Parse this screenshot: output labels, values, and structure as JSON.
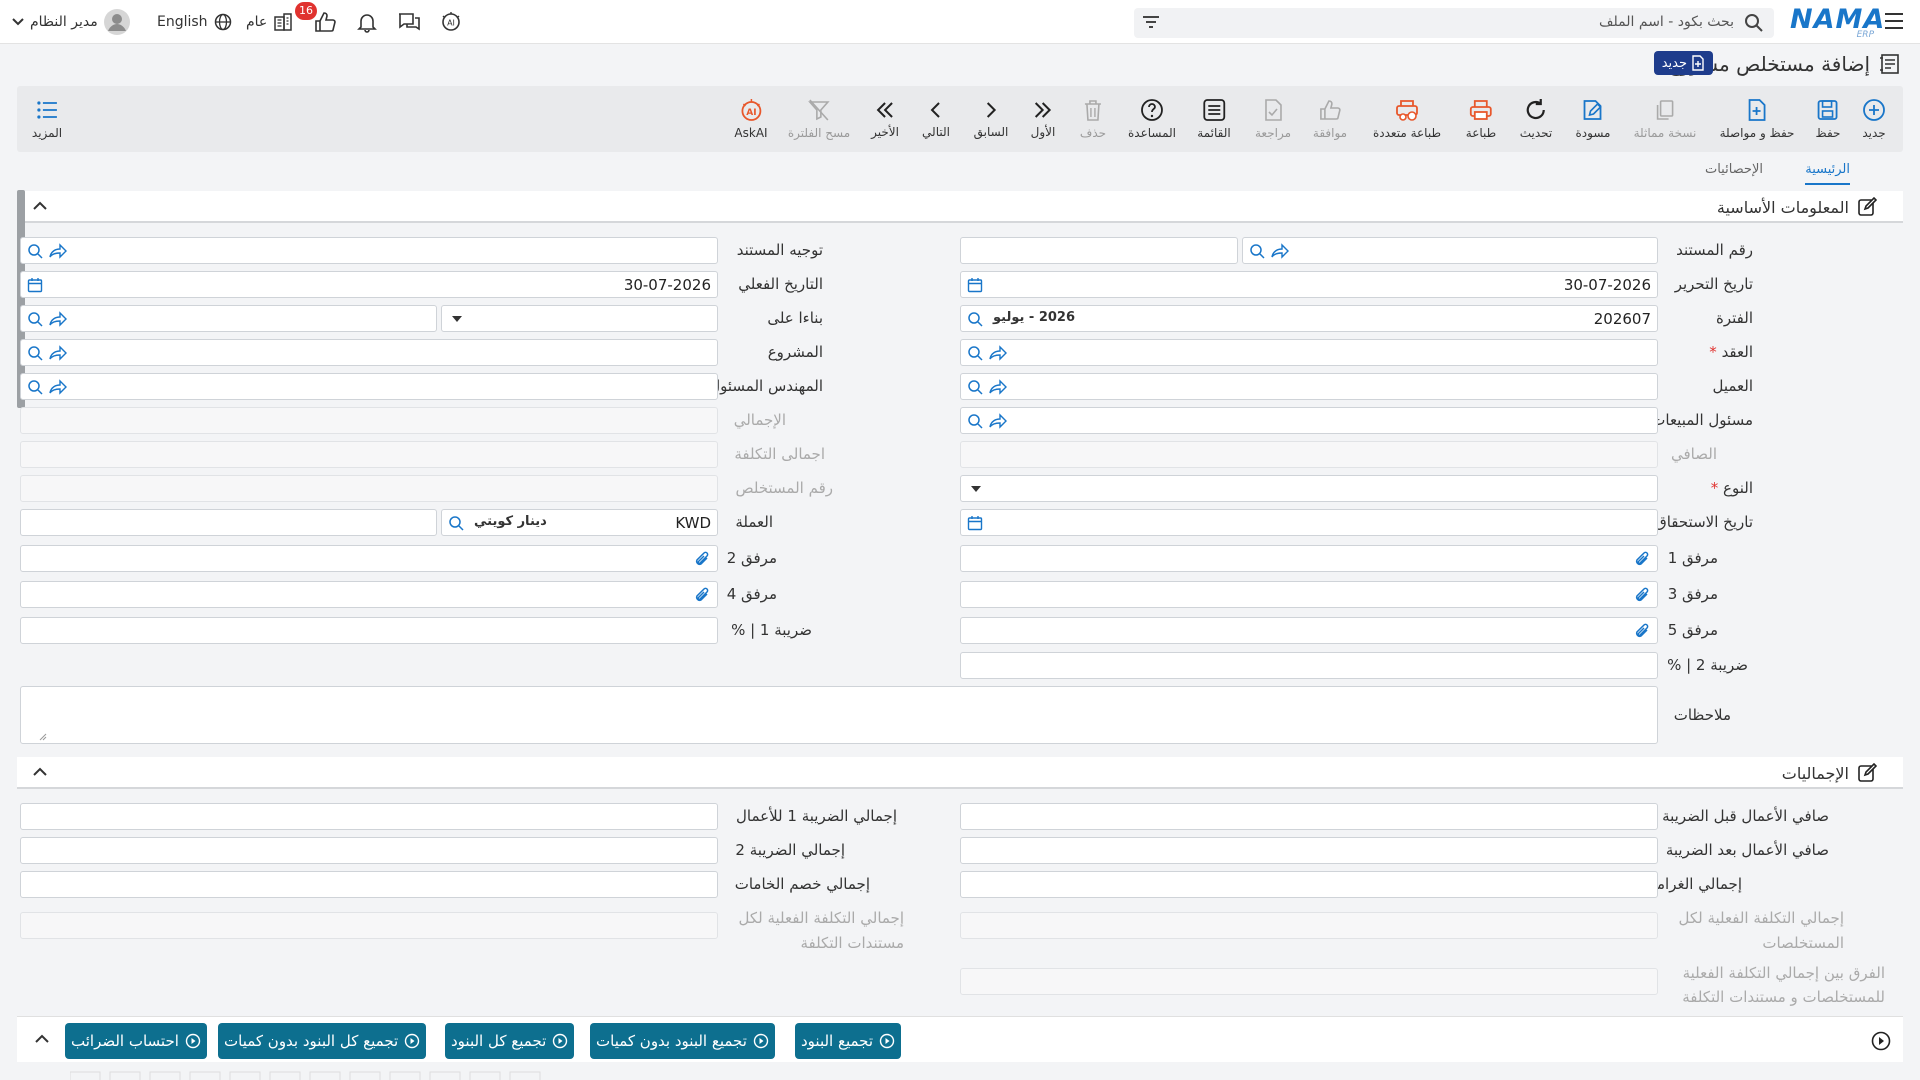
{
  "topbar": {
    "logo_main": "NAMA",
    "logo_sub": "ERP",
    "search_placeholder": "بحث بكود - اسم الملف",
    "user_name": "مدير النظام",
    "language": "English",
    "scope": "عام",
    "notifications_count": "16"
  },
  "page": {
    "title": "إضافة مستخلص مشروع",
    "new_badge": "جديد"
  },
  "toolbar": {
    "new": "جديد",
    "save": "حفظ",
    "save_continue": "حفظ و مواصلة",
    "copy": "نسخة مماثلة",
    "draft": "مسودة",
    "refresh": "تحديث",
    "print": "طباعة",
    "multi_print": "طباعة متعددة",
    "approve": "موافقة",
    "review": "مراجعة",
    "list": "القائمة",
    "help": "المساعدة",
    "delete": "حذف",
    "first": "الأول",
    "previous": "السابق",
    "next": "التالي",
    "last": "الأخير",
    "clear_filter": "مسح الفلترة",
    "askai": "AskAI",
    "more": "المزيد"
  },
  "tabs": {
    "main": "الرئيسية",
    "stats": "الإحصائيات"
  },
  "basic": {
    "title": "المعلومات الأساسية",
    "doc_number_label": "رقم المستند",
    "doc_direction_label": "توجيه المستند",
    "edit_date_label": "تاريخ التحرير",
    "edit_date_value": "30-07-2026",
    "actual_date_label": "التاريخ الفعلي",
    "actual_date_value": "30-07-2026",
    "period_label": "الفترة",
    "period_value": "202607",
    "period_chip": "2026 - يوليو",
    "based_on_label": "بناءا على",
    "contract_label": "العقد",
    "project_label": "المشروع",
    "customer_label": "العميل",
    "engineer_label": "المهندس المسئول",
    "sales_label": "مسئول المبيعات",
    "total_label": "الإجمالي",
    "net_label": "الصافي",
    "total_cost_label": "اجمالى التكلفة",
    "type_label": "النوع",
    "extract_no_label": "رقم المستخلص",
    "due_date_label": "تاريخ الاستحقاق",
    "currency_label": "العملة",
    "currency_code": "KWD",
    "currency_name": "دينار كويتي",
    "att1_label": "مرفق 1",
    "att2_label": "مرفق 2",
    "att3_label": "مرفق 3",
    "att4_label": "مرفق 4",
    "att5_label": "مرفق 5",
    "tax1_label": "ضريبة 1 | %",
    "tax2_label": "ضريبة 2 | %",
    "notes_label": "ملاحظات",
    "required_mark": "*"
  },
  "totals": {
    "title": "الإجماليات",
    "net_before_tax": "صافي الأعمال قبل الضريبة",
    "tax1_total": "إجمالي الضريبة 1 للأعمال",
    "net_after_tax": "صافي الأعمال بعد الضريبة",
    "tax2_total": "إجمالي الضريبة 2",
    "fines_total": "إجمالي الغرامات",
    "materials_total": "إجمالي خصم الخامات",
    "actual_cost_extracts_1": "إجمالي التكلفة الفعلية لكل",
    "actual_cost_extracts_2": "المستخلصات",
    "actual_cost_docs_1": "إجمالي التكلفة الفعلية لكل",
    "actual_cost_docs_2": "مستندات التكلفة",
    "diff_1": "الفرق بين إجمالي التكلفة الفعلية",
    "diff_2": "للمستخلصات و مستندات التكلفة"
  },
  "actions": {
    "group_items": "تجميع البنود",
    "group_items_no_qty": "تجميع البنود بدون كميات",
    "group_all_items": "تجميع كل البنود",
    "group_all_no_qty": "تجميع كل البنود بدون كميات",
    "calc_taxes": "احتساب الضرائب"
  },
  "colors": {
    "brand": "#1976c9",
    "action_button": "#0d6f8f",
    "badge": "#e0322f",
    "new_badge": "#1e3c8c",
    "toolbar_print": "#e8572b"
  }
}
